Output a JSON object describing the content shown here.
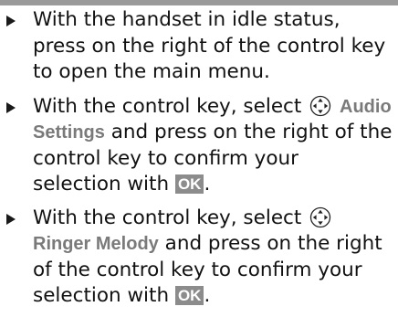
{
  "steps": [
    {
      "text": "With the handset in idle status, press on the right of the control key to open the main menu."
    },
    {
      "before": "With the control key, select",
      "keyword": "Audio Settings",
      "after": "and press on the right of the control key to confirm your selection with",
      "softkey": "OK",
      "end": "."
    },
    {
      "before": "With the control key, select",
      "keyword": "Ringer Melody",
      "after": "and press on the right of the control key to confirm your selection with",
      "softkey": "OK",
      "end": "."
    }
  ],
  "icons": {
    "bullet": "triangle-bullet-icon",
    "control_key": "control-key-icon"
  },
  "colors": {
    "keyword": "#7a7a7a",
    "softkey_bg": "#8c8c8c",
    "top_bar": "#9a9a9a"
  }
}
